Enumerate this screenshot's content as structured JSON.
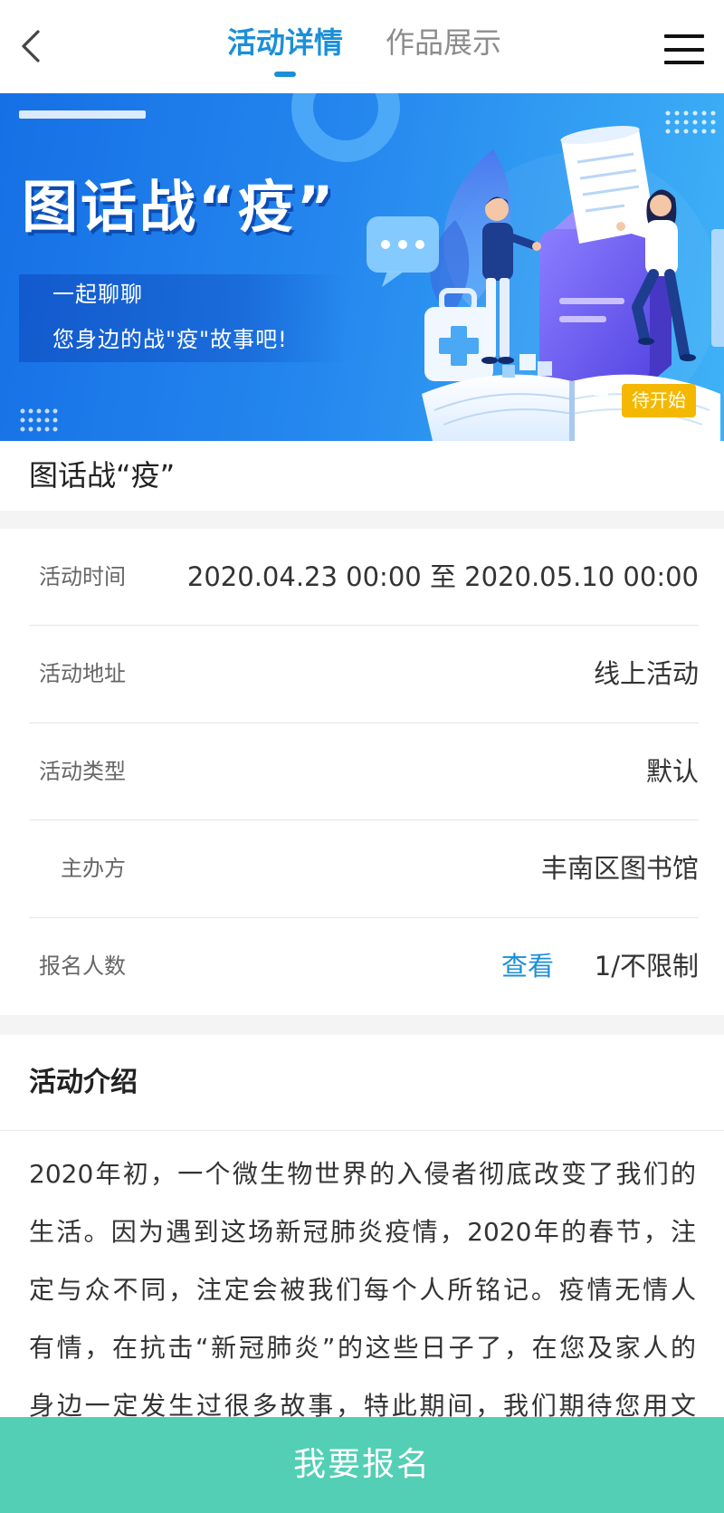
{
  "header": {
    "back_icon": "chevron-left-icon",
    "tabs": [
      {
        "label": "活动详情",
        "active": true
      },
      {
        "label": "作品展示",
        "active": false
      }
    ],
    "menu_icon": "hamburger-menu-icon"
  },
  "banner": {
    "title": "图话战“疫”",
    "subtitle_line1": "一起聊聊",
    "subtitle_line2": "您身边的战\"疫\"故事吧!",
    "status_badge": "待开始"
  },
  "activity": {
    "title": "图话战“疫”",
    "details": [
      {
        "label": "活动时间",
        "value": "2020.04.23 00:00 至 2020.05.10 00:00"
      },
      {
        "label": "活动地址",
        "value": "线上活动"
      },
      {
        "label": "活动类型",
        "value": "默认"
      },
      {
        "label": "主办方",
        "value": "丰南区图书馆"
      }
    ],
    "signup_count": {
      "label": "报名人数",
      "link": "查看",
      "value": "1/不限制"
    }
  },
  "intro": {
    "heading": "活动介绍",
    "lines": [
      "2020年初，一个微生物世界的入侵者彻底改变了我们的",
      "生活。因为遇到这场新冠肺炎疫情，2020年的春节，注",
      "定与众不同，注定会被我们每个人所铭记。疫情无情人",
      "有情，在抗击“新冠肺炎”的这些日子了，在您及家人的",
      "身边一定发生过很多故事，特此期间，我们期待您用文"
    ]
  },
  "footer": {
    "signup_button": "我要报名"
  },
  "colors": {
    "accent": "#1b8fd8",
    "signup_button": "#52cfb4",
    "status_badge": "#f5b800",
    "banner_start": "#1670e5",
    "banner_end": "#3fb2f7"
  }
}
